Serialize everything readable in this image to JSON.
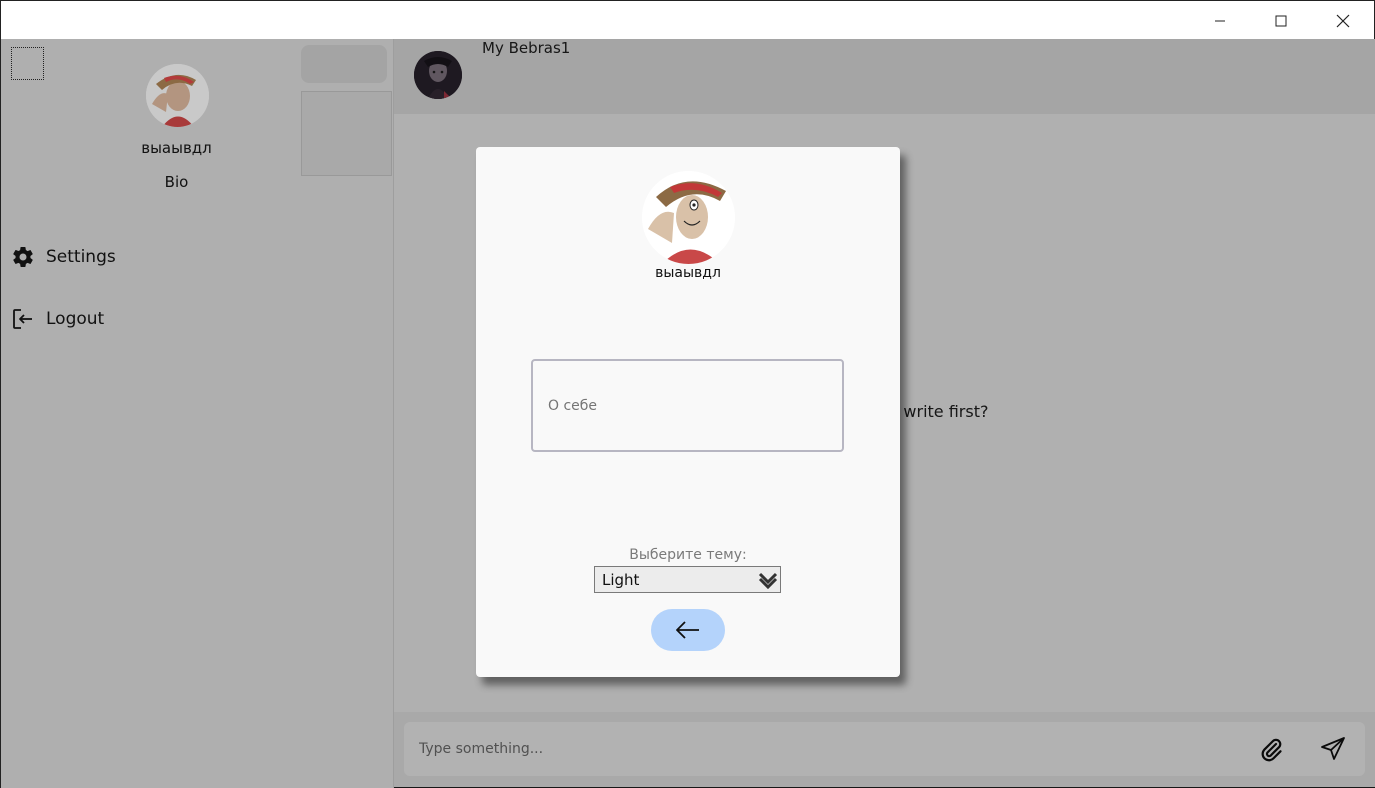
{
  "window": {
    "minimize_icon": "minimize-icon",
    "maximize_icon": "maximize-icon",
    "close_icon": "close-icon"
  },
  "chat": {
    "title": "My Bebras1",
    "empty_message": "o you want to write first?",
    "input_placeholder": "Type something...",
    "attach_icon": "paperclip-icon",
    "send_icon": "send-icon"
  },
  "drawer": {
    "username": "выаывдл",
    "bio": "Bio",
    "menu": [
      {
        "label": "Settings",
        "icon": "gear-icon"
      },
      {
        "label": "Logout",
        "icon": "logout-icon"
      }
    ]
  },
  "settings_dialog": {
    "username": "выаывдл",
    "bio_placeholder": "О себе",
    "theme_label": "Выберите тему:",
    "theme_value": "Light",
    "back_icon": "arrow-left-icon"
  },
  "colors": {
    "accent_button": "#b4d3fb",
    "overlay": "rgba(0,0,0,0.30)"
  }
}
